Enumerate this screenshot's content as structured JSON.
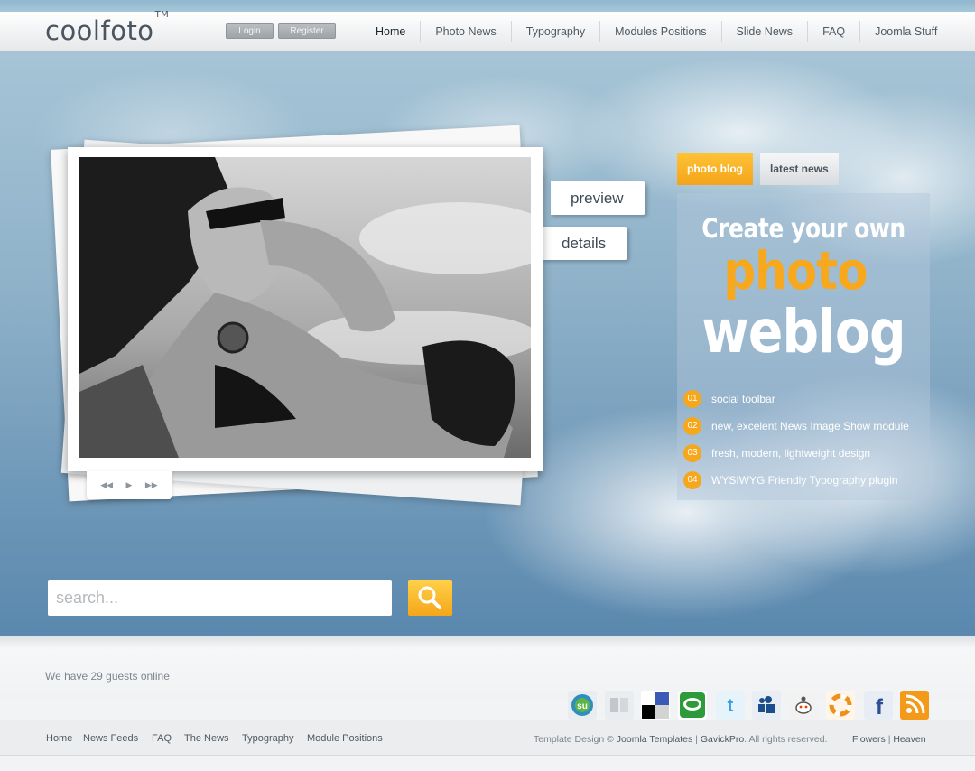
{
  "header": {
    "logo": "coolfoto",
    "logo_tm": "TM",
    "login_label": "Login",
    "register_label": "Register",
    "nav": [
      {
        "label": "Home"
      },
      {
        "label": "Photo News"
      },
      {
        "label": "Typography"
      },
      {
        "label": "Modules Positions"
      },
      {
        "label": "Slide News"
      },
      {
        "label": "FAQ"
      },
      {
        "label": "Joomla Stuff"
      }
    ]
  },
  "slideshow": {
    "preview_label": "preview",
    "details_label": "details",
    "controls": [
      "prev-icon",
      "play-icon",
      "next-icon"
    ]
  },
  "tabs": {
    "active": "photo blog",
    "inactive": "latest news"
  },
  "promo": {
    "line1": "Create your own",
    "line2": "photo",
    "line3": "weblog",
    "features": [
      {
        "num": "01",
        "text": "social toolbar"
      },
      {
        "num": "02",
        "text": "new, excelent News Image Show module"
      },
      {
        "num": "03",
        "text": "fresh, modern, lightweight design"
      },
      {
        "num": "04",
        "text": "WYSIWYG Friendly Typography plugin"
      }
    ]
  },
  "search": {
    "placeholder": "search...",
    "icon": "magnifier-icon"
  },
  "footer": {
    "guests": "We have 29 guests online",
    "social_icons": [
      "stumbleupon-icon",
      "mixx-icon",
      "delicious-icon",
      "chat-icon",
      "twitter-icon",
      "myspace-icon",
      "reddit-icon",
      "lifesaver-icon",
      "facebook-icon",
      "rss-icon"
    ],
    "links": [
      "Home",
      "News Feeds",
      "FAQ",
      "The News",
      "Typography",
      "Module Positions"
    ],
    "copyright_pre": "Template Design ©",
    "copyright_link1": "Joomla Templates",
    "copyright_sep": "|",
    "copyright_link2": "GavickPro",
    "copyright_post": ". All rights reserved.",
    "theme_link1": "Flowers",
    "theme_link2": "Heaven"
  },
  "colors": {
    "accent": "#f6a71c",
    "sky": "#8fb2c9"
  }
}
